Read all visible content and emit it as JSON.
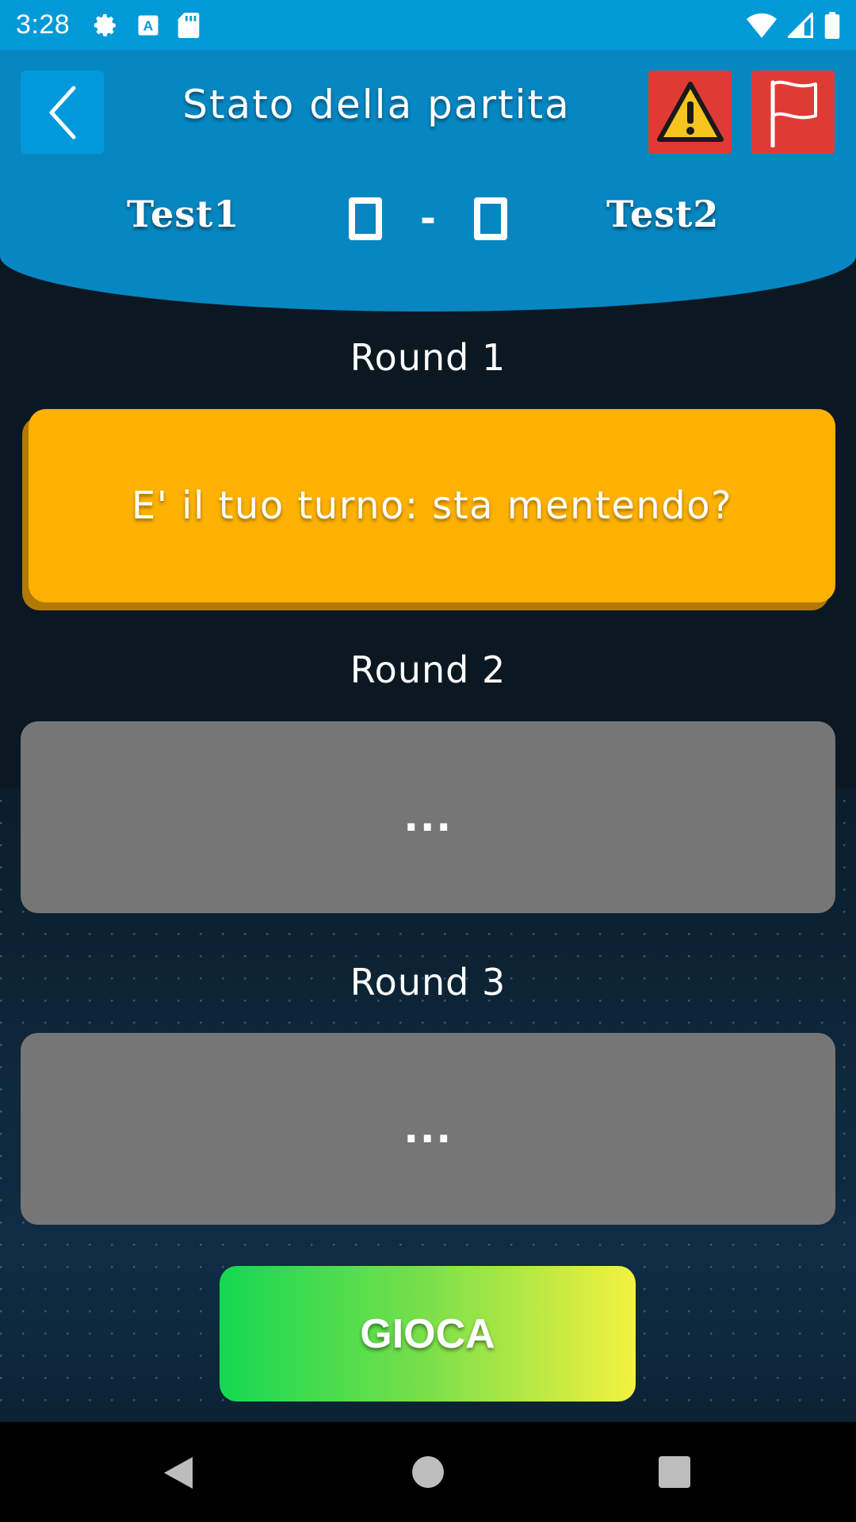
{
  "status_bar": {
    "time": "3:28",
    "left_icons": [
      "gear-icon",
      "text-a-icon",
      "sd-card-icon"
    ],
    "right_icons": [
      "wifi-icon",
      "signal-icon",
      "battery-icon"
    ]
  },
  "header": {
    "title": "Stato della partita",
    "back_icon": "chevron-left-icon",
    "warning_icon": "warning-icon",
    "flag_icon": "flag-icon",
    "player_left": "Test1",
    "player_right": "Test2",
    "score_left": "0",
    "score_separator": "-",
    "score_right": "0"
  },
  "rounds": [
    {
      "label": "Round 1",
      "text": "E' il tuo turno: sta mentendo?"
    },
    {
      "label": "Round 2",
      "text": "..."
    },
    {
      "label": "Round 3",
      "text": "..."
    }
  ],
  "play_button": {
    "label": "GIOCA"
  },
  "colors": {
    "status_bar": "#0199d6",
    "header": "#0687c2",
    "active_round": "#fdb102",
    "pending_round": "#767676",
    "danger": "#e03a35"
  }
}
